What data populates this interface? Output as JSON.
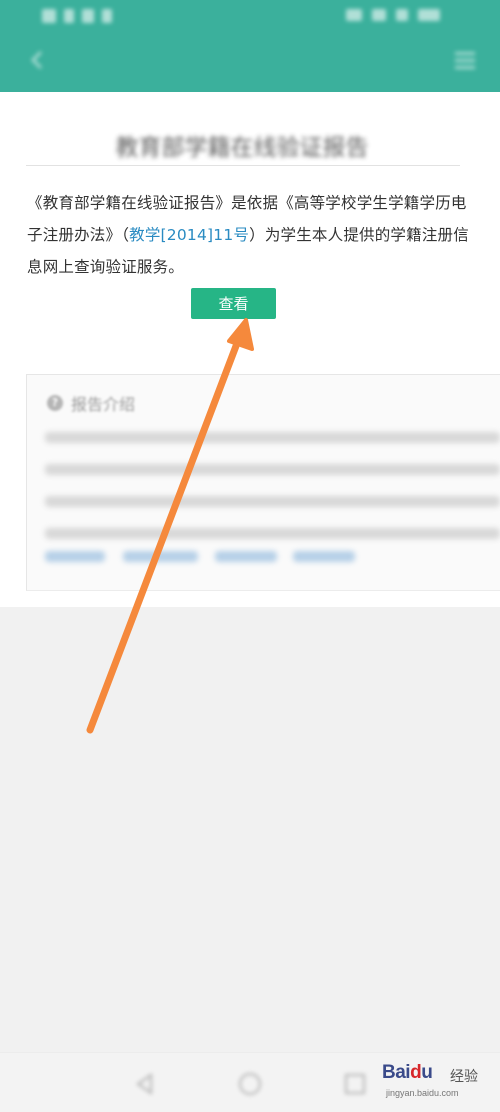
{
  "page": {
    "title": "教育部学籍在线验证报告",
    "description": {
      "part1": "《教育部学籍在线验证报告》是依据《高等学校学生学籍学历电子注册办法》（",
      "link": "教学[2014]11号",
      "part2": "）为学生本人提供的学籍注册信息网上查询验证服务。"
    },
    "view_button_label": "查看"
  },
  "report_intro": {
    "icon": "help-icon",
    "icon_glyph": "?",
    "title": "报告介绍"
  },
  "watermark": {
    "logo_left": "Bai",
    "logo_paw": "d",
    "logo_right": "u",
    "sub": "经验",
    "url": "jingyan.baidu.com"
  },
  "colors": {
    "header": "#3bb09c",
    "button": "#26b586",
    "link": "#2a8bc2",
    "arrow": "#f5893c"
  }
}
